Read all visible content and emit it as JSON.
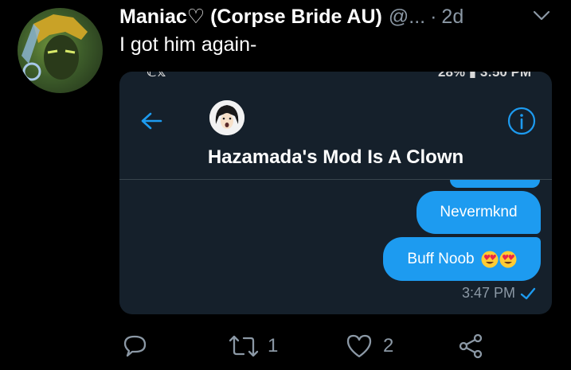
{
  "tweet": {
    "author_name": "Maniac♡ (Corpse Bride AU)",
    "handle": "@...",
    "separator": "·",
    "time": "2d",
    "text": "I got him again-"
  },
  "embedded_screenshot": {
    "statusbar_left": "ℂ𝕩",
    "statusbar_right": "28% ▮ 3:50 PM",
    "chat_title": "Hazamada's Mod Is A Clown",
    "messages": [
      {
        "text": "Nevermknd"
      },
      {
        "text": "Buff Noob"
      }
    ],
    "message_time": "3:47 PM",
    "colors": {
      "bubble": "#1d9bf0",
      "background": "#15202b"
    }
  },
  "actions": {
    "reply_count": "",
    "retweet_count": "1",
    "like_count": "2"
  },
  "icons": [
    "chevron-down-icon",
    "back-arrow-icon",
    "info-icon",
    "heart-eyes-emoji",
    "check-icon",
    "reply-icon",
    "retweet-icon",
    "like-icon",
    "share-icon"
  ]
}
